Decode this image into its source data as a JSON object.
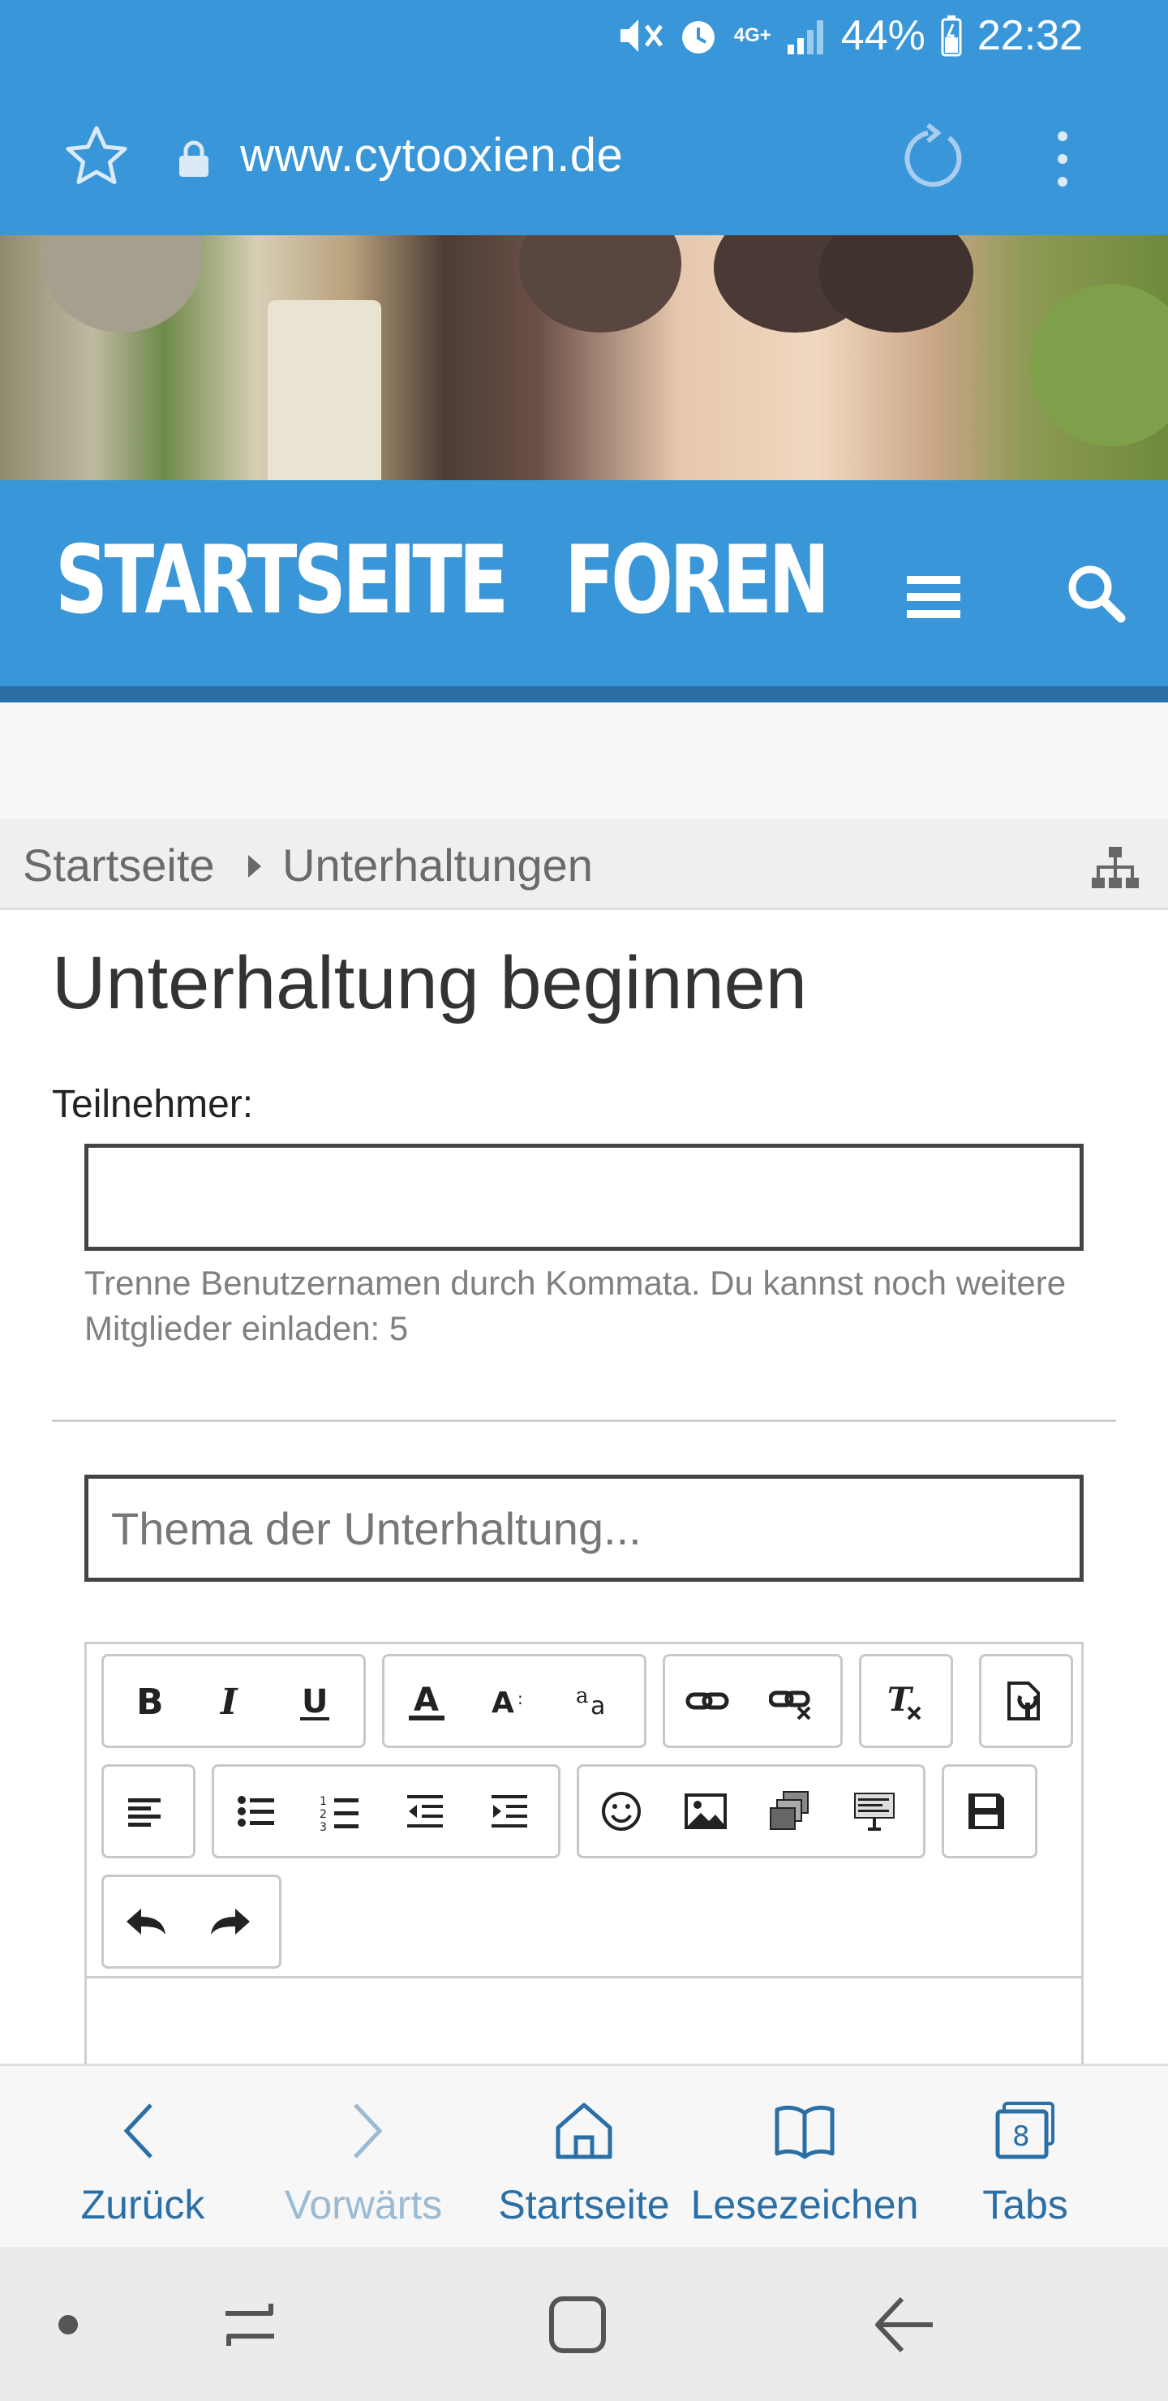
{
  "status_bar": {
    "network": "4G+",
    "battery": "44%",
    "time": "22:32"
  },
  "browser": {
    "url": "www.cytooxien.de"
  },
  "nav": {
    "home_label": "STARTSEITE",
    "forums_label": "FOREN"
  },
  "breadcrumb": {
    "items": [
      "Startseite",
      "Unterhaltungen"
    ]
  },
  "main": {
    "title": "Unterhaltung beginnen",
    "participants_label": "Teilnehmer:",
    "participants_value": "",
    "participants_hint": "Trenne Benutzernamen durch Kommata. Du kannst noch weitere Mitglieder einladen: 5",
    "subject_placeholder": "Thema der Unterhaltung..."
  },
  "editor": {
    "toolbar_rows": [
      [
        "bold",
        "italic",
        "underline",
        "font-color",
        "font-size",
        "font-family",
        "link",
        "unlink",
        "remove-format",
        "media"
      ],
      [
        "align",
        "bullet-list",
        "number-list",
        "outdent",
        "indent",
        "smilies",
        "image",
        "gallery",
        "code",
        "drafts"
      ],
      [
        "undo",
        "redo"
      ]
    ]
  },
  "bottom_nav": {
    "back": "Zurück",
    "forward": "Vorwärts",
    "home": "Startseite",
    "bookmarks": "Lesezeichen",
    "tabs": "Tabs",
    "tab_count": "8"
  },
  "colors": {
    "primary": "#3997d9",
    "link": "#2a6fa6"
  }
}
